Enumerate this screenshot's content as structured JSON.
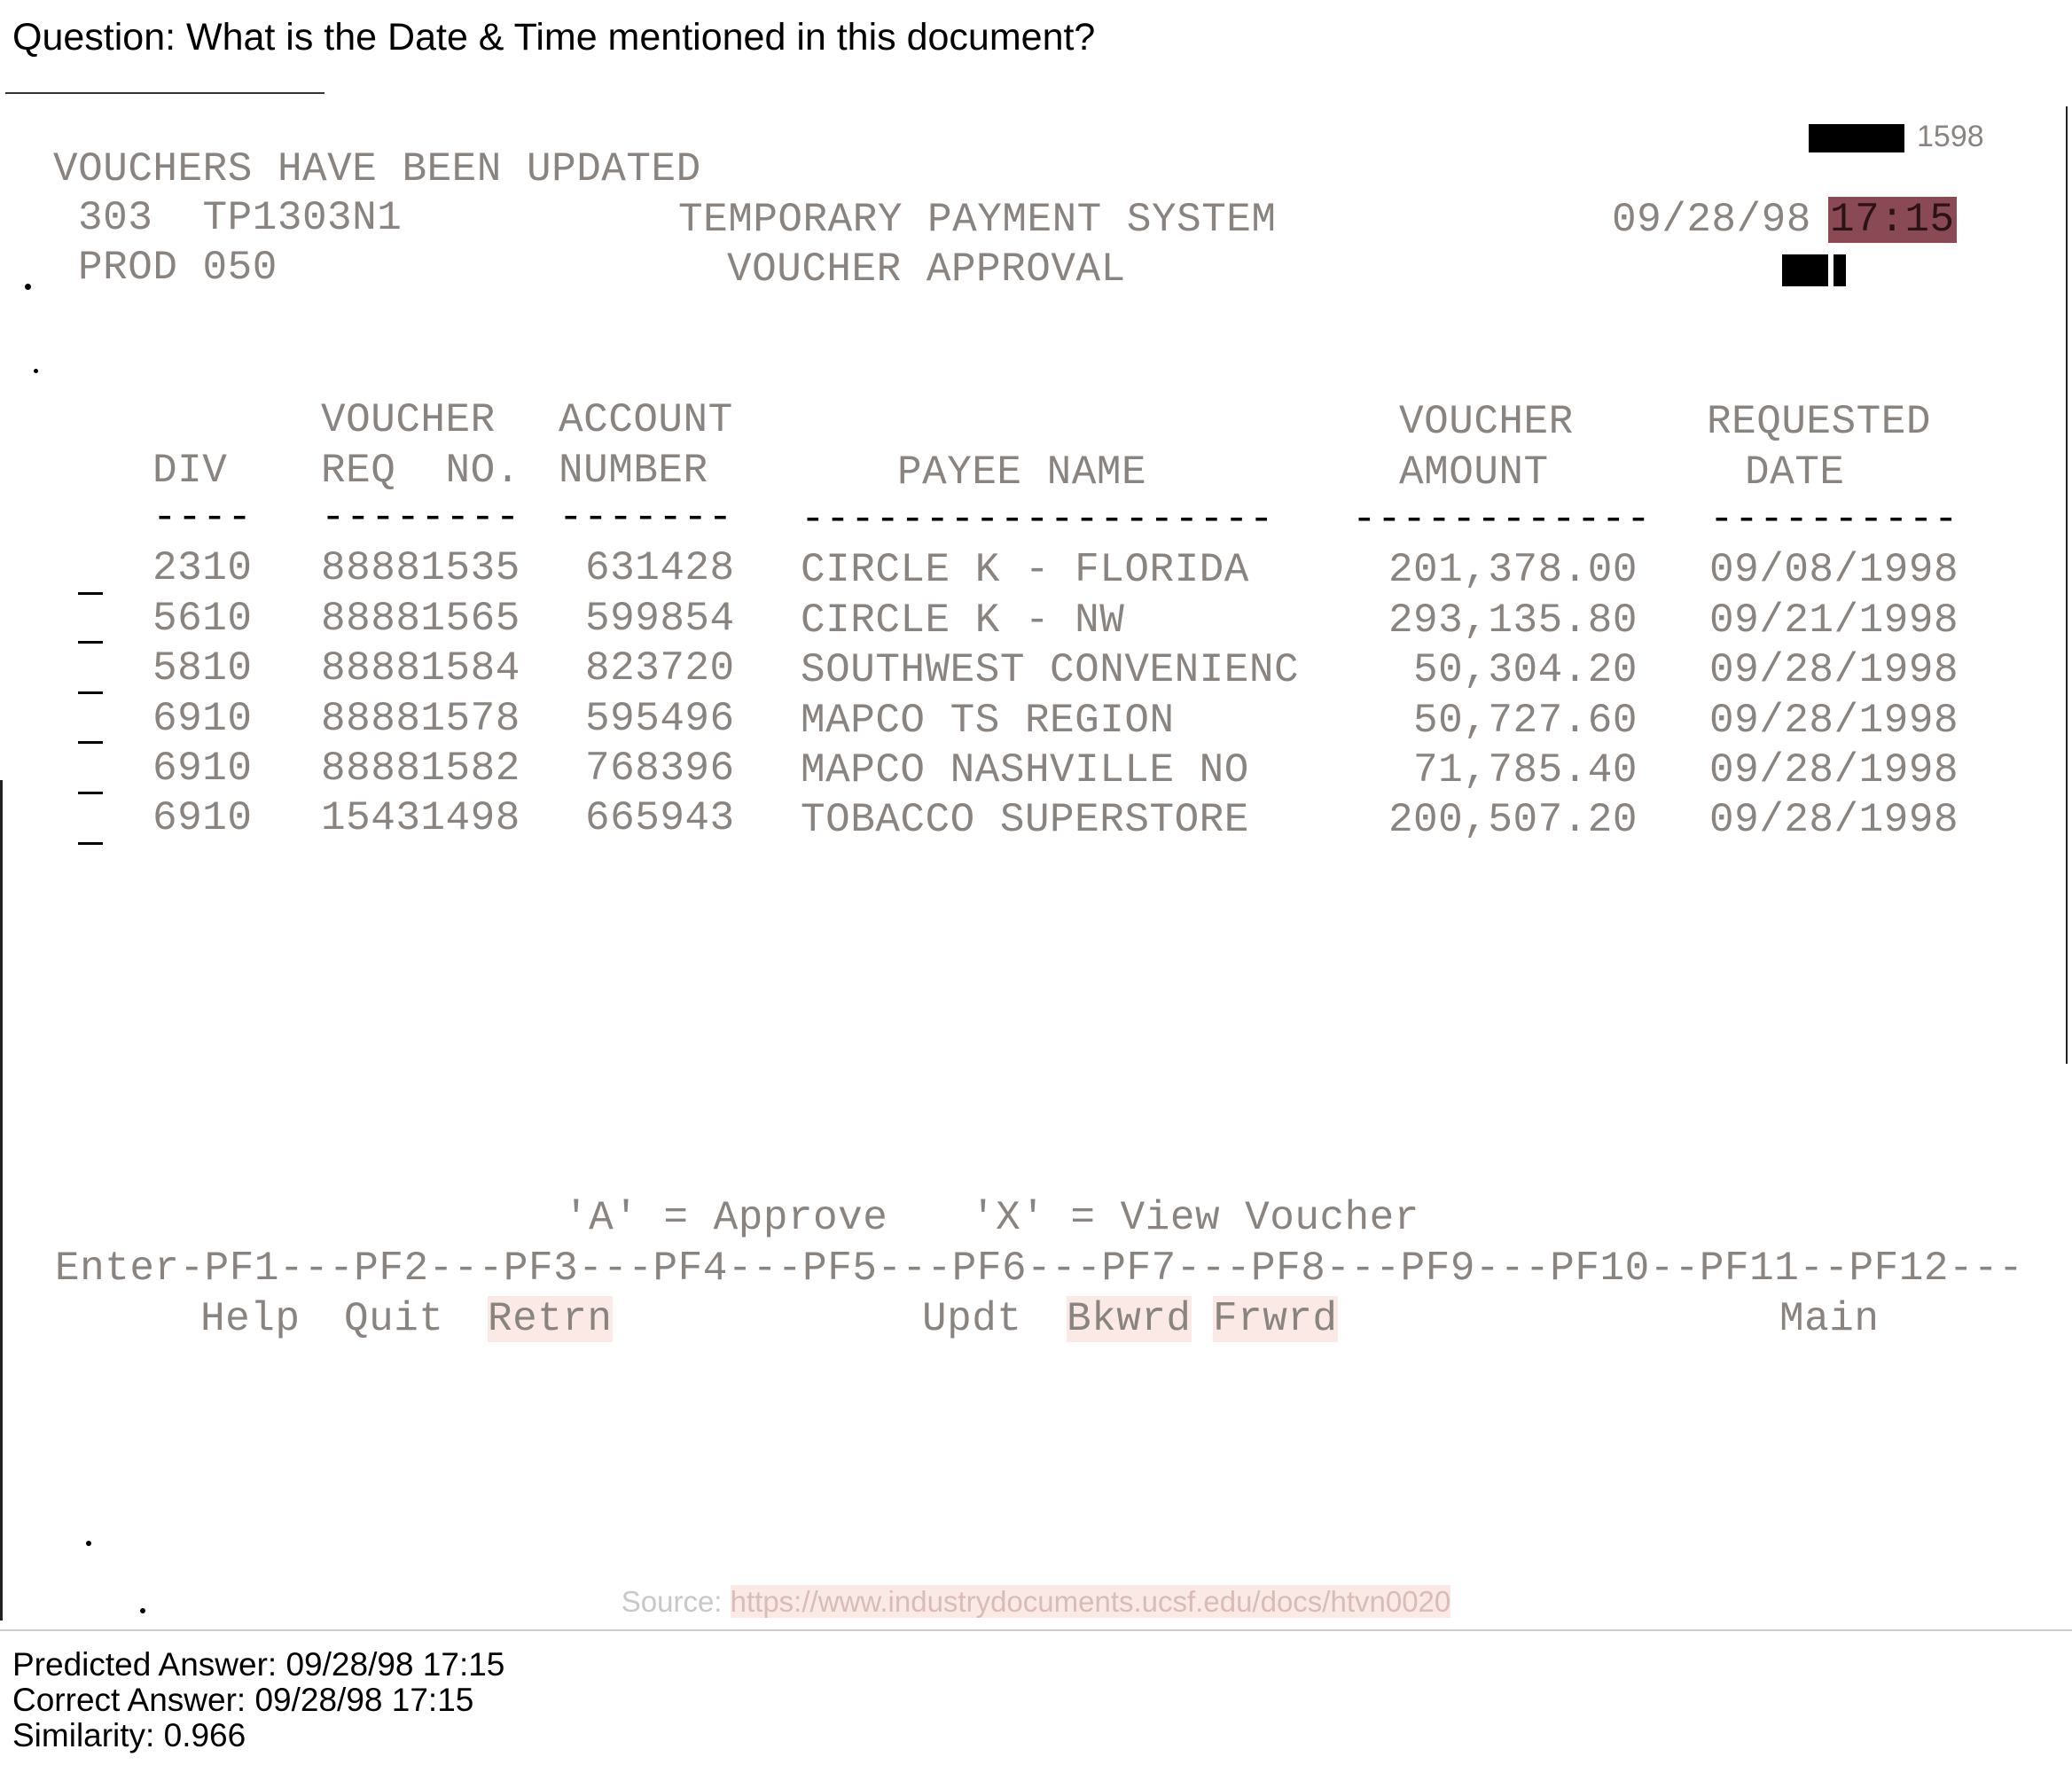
{
  "question": "Question: What is the Date & Time mentioned in this document?",
  "header": {
    "doc_number": "1598",
    "status": "VOUCHERS HAVE BEEN UPDATED",
    "code_line1_left": "303  TP1303N1",
    "code_line2_left": "PROD 050",
    "system_title": "TEMPORARY PAYMENT SYSTEM",
    "screen_title": "VOUCHER APPROVAL",
    "date": "09/28/98",
    "time": "17:15"
  },
  "table": {
    "headers": {
      "div": [
        "",
        "DIV"
      ],
      "voucher_req_no": [
        "VOUCHER",
        "REQ  NO."
      ],
      "account_number": [
        "ACCOUNT",
        "NUMBER"
      ],
      "payee_name": [
        "",
        "PAYEE NAME"
      ],
      "voucher_amount": [
        "VOUCHER",
        "AMOUNT"
      ],
      "requested_date": [
        "REQUESTED",
        "DATE"
      ]
    },
    "dashes": {
      "div": "----",
      "voucher_req_no": "--------",
      "account_number": "-------",
      "payee_name": "-------------------",
      "voucher_amount": "------------",
      "requested_date": "----------"
    },
    "rows": [
      {
        "div": "2310",
        "voucher_no": "88881535",
        "account": "631428",
        "payee": "CIRCLE K - FLORIDA",
        "amount": "201,378.00",
        "date": "09/08/1998"
      },
      {
        "div": "5610",
        "voucher_no": "88881565",
        "account": "599854",
        "payee": "CIRCLE K - NW",
        "amount": "293,135.80",
        "date": "09/21/1998"
      },
      {
        "div": "5810",
        "voucher_no": "88881584",
        "account": "823720",
        "payee": "SOUTHWEST CONVENIENC",
        "amount": "50,304.20",
        "date": "09/28/1998"
      },
      {
        "div": "6910",
        "voucher_no": "88881578",
        "account": "595496",
        "payee": "MAPCO TS REGION",
        "amount": "50,727.60",
        "date": "09/28/1998"
      },
      {
        "div": "6910",
        "voucher_no": "88881582",
        "account": "768396",
        "payee": "MAPCO NASHVILLE NO",
        "amount": "71,785.40",
        "date": "09/28/1998"
      },
      {
        "div": "6910",
        "voucher_no": "15431498",
        "account": "665943",
        "payee": "TOBACCO SUPERSTORE",
        "amount": "200,507.20",
        "date": "09/28/1998"
      }
    ]
  },
  "legend": {
    "approve": "'A' = Approve",
    "view": "'X' = View Voucher"
  },
  "pf_keys_line": "Enter-PF1---PF2---PF3---PF4---PF5---PF6---PF7---PF8---PF9---PF10--PF11--PF12---",
  "pf_labels": {
    "help": "Help",
    "quit": "Quit",
    "retrn": "Retrn",
    "updt": "Updt",
    "bkwrd": "Bkwrd",
    "frwrd": "Frwrd",
    "main": "Main"
  },
  "source": {
    "label": "Source: ",
    "url": "https://www.industrydocuments.ucsf.edu/docs/htvn0020"
  },
  "answers": {
    "predicted": "Predicted Answer: 09/28/98 17:15",
    "correct": "Correct Answer: 09/28/98  17:15",
    "similarity": "Similarity: 0.966"
  }
}
